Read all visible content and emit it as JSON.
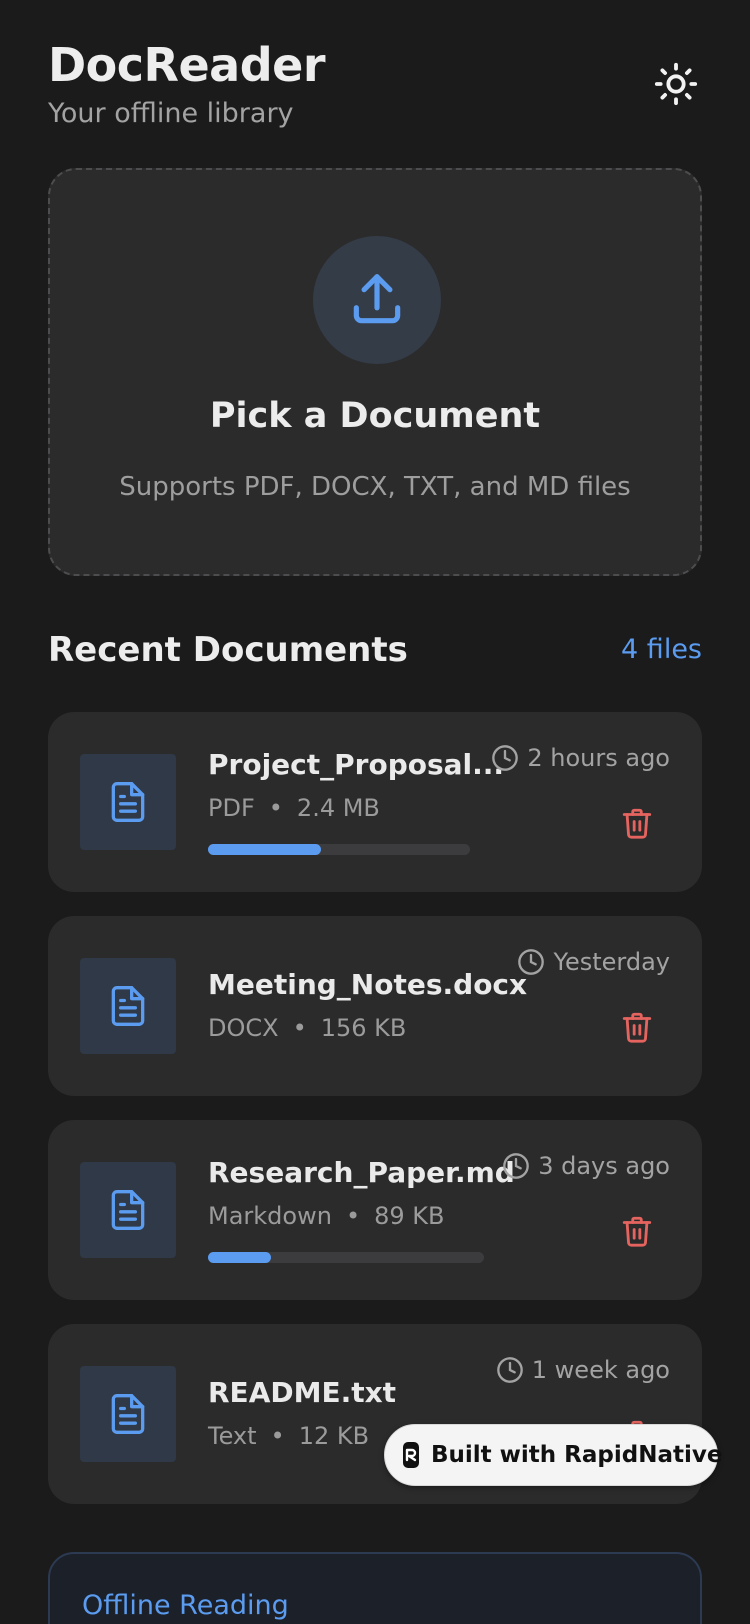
{
  "header": {
    "title": "DocReader",
    "subtitle": "Your offline library",
    "theme_icon": "sun-icon"
  },
  "picker": {
    "icon": "upload-icon",
    "title": "Pick a Document",
    "subtitle": "Supports PDF, DOCX, TXT, and MD files"
  },
  "recent": {
    "title": "Recent Documents",
    "count": "4 files",
    "documents": [
      {
        "name": "Project_Proposal...",
        "type": "PDF",
        "separator": "•",
        "size": "2.4 MB",
        "time": "2 hours ago",
        "progress": 0.43
      },
      {
        "name": "Meeting_Notes.docx",
        "type": "DOCX",
        "separator": "•",
        "size": "156 KB",
        "time": "Yesterday",
        "progress": null
      },
      {
        "name": "Research_Paper.md",
        "type": "Markdown",
        "separator": "•",
        "size": "89 KB",
        "time": "3 days ago",
        "progress": 0.23
      },
      {
        "name": "README.txt",
        "type": "Text",
        "separator": "•",
        "size": "12 KB",
        "time": "1 week ago",
        "progress": null
      }
    ]
  },
  "badge": {
    "label": "Built with RapidNative"
  },
  "offline": {
    "title": "Offline Reading"
  },
  "colors": {
    "accent": "#5b9cf0",
    "danger": "#e5645f",
    "background": "#1b1b1c",
    "card": "#2b2b2c"
  }
}
